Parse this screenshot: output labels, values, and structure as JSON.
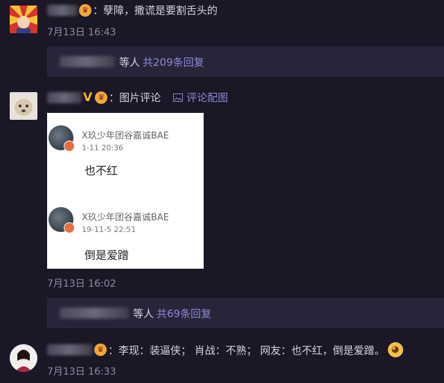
{
  "comments": [
    {
      "text": "：孽障，撒谎是要割舌头的",
      "time": "7月13日 16:43",
      "reply": {
        "label": "等人",
        "count": "共209条回复"
      }
    },
    {
      "text": "：图片评论",
      "image_link": "评论配图",
      "time": "7月13日 16:02",
      "image_card": {
        "items": [
          {
            "name": "X玖少年团谷嘉诚BAE",
            "time": "1-11 20:36",
            "text": "也不红"
          },
          {
            "name": "X玖少年团谷嘉诚BAE",
            "time": "19-11-5 22:51",
            "text": "倒是爱蹭"
          }
        ]
      },
      "reply": {
        "label": "等人",
        "count": "共69条回复"
      }
    },
    {
      "text": "：李现：装逼侠；  肖战：不熟；  网友：也不红，倒是爱蹭。",
      "time": "7月13日 16:33"
    }
  ],
  "badges": {
    "vip": "V",
    "crown": "♛"
  },
  "colors": {
    "background": "#1a1727",
    "accent": "#8c87d8",
    "reply_bar": "#28253a"
  },
  "icons": [
    "image-icon",
    "doge-emoji-icon"
  ]
}
